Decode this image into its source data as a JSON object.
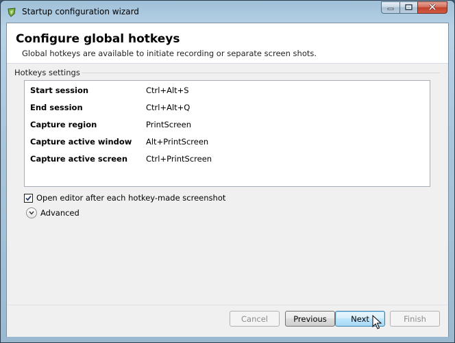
{
  "window": {
    "title": "Startup configuration wizard",
    "icons": {
      "app": "app-shield-icon",
      "minimize": "minimize-icon",
      "maximize": "maximize-icon",
      "close": "close-icon"
    }
  },
  "header": {
    "title": "Configure global hotkeys",
    "subtitle": "Global hotkeys are available to initiate recording or separate screen shots."
  },
  "hotkeys": {
    "group_label": "Hotkeys settings",
    "items": [
      {
        "name": "Start session",
        "key": "Ctrl+Alt+S"
      },
      {
        "name": "End session",
        "key": "Ctrl+Alt+Q"
      },
      {
        "name": "Capture region",
        "key": "PrintScreen"
      },
      {
        "name": "Capture active window",
        "key": "Alt+PrintScreen"
      },
      {
        "name": "Capture active screen",
        "key": "Ctrl+PrintScreen"
      }
    ]
  },
  "options": {
    "open_editor_label": "Open editor after each hotkey-made screenshot",
    "open_editor_checked": true,
    "advanced_label": "Advanced"
  },
  "buttons": {
    "cancel": "Cancel",
    "previous": "Previous",
    "next": "Next",
    "finish": "Finish"
  }
}
